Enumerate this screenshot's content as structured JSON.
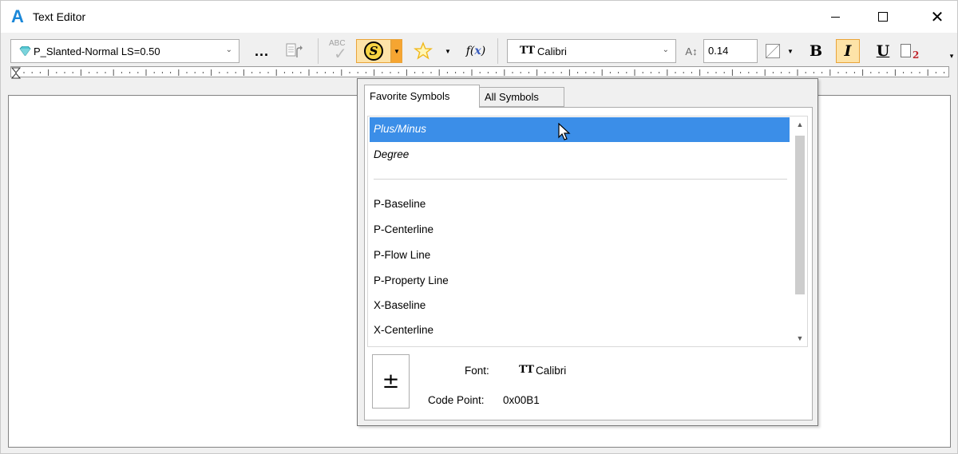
{
  "window": {
    "logo": "A",
    "title": "Text Editor",
    "controls": {
      "minimize": "minimize",
      "maximize": "maximize",
      "close": "✕"
    }
  },
  "toolbar": {
    "text_style": "P_Slanted-Normal LS=0.50",
    "more_label": "...",
    "spell_label": "ABC",
    "symbol_label": "S",
    "font_name": "Calibri",
    "font_icon": "TT",
    "text_height": "0.14",
    "bold_label": "B",
    "italic_label": "I",
    "underline_label": "U",
    "subscript_num": "2",
    "colors": {
      "accent_active": "#fde3a8",
      "accent_border": "#e9a43a",
      "selection": "#3b8ee8",
      "logo": "#1a87d8"
    }
  },
  "symbols_popup": {
    "tabs": [
      {
        "label": "Favorite Symbols",
        "active": true
      },
      {
        "label": "All Symbols",
        "active": false
      }
    ],
    "favorites": [
      {
        "label": "Plus/Minus",
        "selected": true
      },
      {
        "label": "Degree",
        "selected": false
      }
    ],
    "symbols": [
      "P-Baseline",
      "P-Centerline",
      "P-Flow Line",
      "P-Property Line",
      "X-Baseline",
      "X-Centerline"
    ],
    "preview_glyph": "±",
    "font_label": "Font:",
    "font_value": "Calibri",
    "code_point_label": "Code Point:",
    "code_point_value": "0x00B1"
  }
}
